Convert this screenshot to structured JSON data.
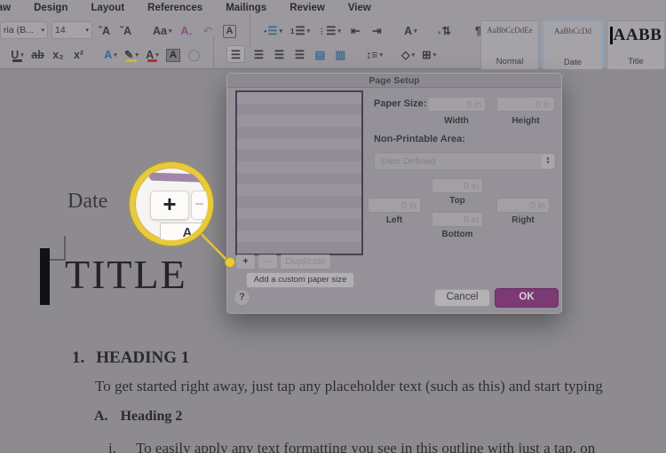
{
  "menu_tabs": [
    "Draw",
    "Design",
    "Layout",
    "References",
    "Mailings",
    "Review",
    "View"
  ],
  "ribbon": {
    "font_name": "ria (B...",
    "font_size": "14",
    "row1_icons": [
      {
        "name": "grow-font-icon",
        "glyph": "A",
        "pre2": "ˆ"
      },
      {
        "name": "shrink-font-icon",
        "glyph": "A",
        "pre2": "ˇ"
      },
      {
        "name": "spacer"
      },
      {
        "name": "change-case-icon",
        "glyph": "Aa",
        "chev": true
      },
      {
        "name": "clear-formatting-icon",
        "glyph": "A․",
        "color": "#8c4d86"
      },
      {
        "name": "circular-arrow-icon",
        "glyph": "↶",
        "faded": true
      },
      {
        "name": "character-border-icon",
        "glyph": "A",
        "box": true
      },
      {
        "name": "divider"
      },
      {
        "name": "bullet-list-icon",
        "glyph": "☰",
        "pre": "•",
        "chev": true,
        "color": "#3d6b94"
      },
      {
        "name": "numbered-list-icon",
        "glyph": "☰",
        "pre": "1",
        "chev": true
      },
      {
        "name": "multilevel-list-icon",
        "glyph": "☰",
        "pre": "⋮",
        "chev": true
      },
      {
        "name": "decrease-indent-icon",
        "glyph": "⇤"
      },
      {
        "name": "increase-indent-icon",
        "glyph": "⇥"
      },
      {
        "name": "spacer"
      },
      {
        "name": "text-effects-icon",
        "glyph": "A",
        "chev": true
      },
      {
        "name": "spacer"
      },
      {
        "name": "sort-icon",
        "glyph": "⇅",
        "pre": "₂"
      },
      {
        "name": "spacer"
      },
      {
        "name": "pilcrow-icon",
        "glyph": "¶"
      }
    ],
    "row2_icons": [
      {
        "name": "underline-icon",
        "glyph": "U",
        "chev": true,
        "bar": "#3c3a3f"
      },
      {
        "name": "strikethrough-icon",
        "glyph": "ab",
        "strike": true
      },
      {
        "name": "subscript-icon",
        "glyph": "x₂"
      },
      {
        "name": "superscript-icon",
        "glyph": "x²"
      },
      {
        "name": "spacer"
      },
      {
        "name": "text-effects-color-icon",
        "glyph": "A",
        "color": "#2f6a9e",
        "chev": true
      },
      {
        "name": "highlight-icon",
        "glyph": "✎",
        "bar": "#cdb92f",
        "chev": true
      },
      {
        "name": "font-color-icon",
        "glyph": "A",
        "bar": "#a8352c",
        "chev": true
      },
      {
        "name": "character-shading-icon",
        "glyph": "A",
        "darkbox": true
      },
      {
        "name": "circle-icon",
        "glyph": "◯",
        "faded": true
      },
      {
        "name": "divider"
      },
      {
        "name": "align-left-icon",
        "glyph": "☰",
        "active": true
      },
      {
        "name": "align-center-icon",
        "glyph": "☰"
      },
      {
        "name": "align-right-icon",
        "glyph": "☰"
      },
      {
        "name": "justify-icon",
        "glyph": "☰"
      },
      {
        "name": "distribute-icon",
        "glyph": "▤",
        "color": "#3d6b94"
      },
      {
        "name": "grid-text-icon",
        "glyph": "▥",
        "color": "#3d6b94"
      },
      {
        "name": "spacer"
      },
      {
        "name": "line-spacing-icon",
        "glyph": "↕≡",
        "chev": true
      },
      {
        "name": "spacer"
      },
      {
        "name": "shading-bucket-icon",
        "glyph": "◇",
        "chev": true
      },
      {
        "name": "borders-icon",
        "glyph": "⊞",
        "chev": true
      }
    ],
    "styles": [
      {
        "name": "style-normal",
        "preview": "AaBbCcDdEe",
        "label": "Normal",
        "selected": false,
        "cursor": false,
        "big": false
      },
      {
        "name": "style-date",
        "preview": "AaBbCcDd",
        "label": "Date",
        "selected": true,
        "cursor": false,
        "big": false
      },
      {
        "name": "style-title",
        "preview": "AABB",
        "label": "Title",
        "selected": false,
        "cursor": true,
        "big": true
      }
    ]
  },
  "dialog": {
    "title": "Page Setup",
    "paper_size_label": "Paper Size:",
    "width": {
      "value": "0 in",
      "label": "Width"
    },
    "height": {
      "value": "0 in",
      "label": "Height"
    },
    "nonprintable_label": "Non-Printable Area:",
    "nonprintable_value": "User Defined",
    "margins": {
      "top": {
        "value": "0 in",
        "label": "Top"
      },
      "left": {
        "value": "0 in",
        "label": "Left"
      },
      "right": {
        "value": "0 in",
        "label": "Right"
      },
      "bottom": {
        "value": "0 in",
        "label": "Bottom"
      }
    },
    "add_label": "+",
    "remove_label": "—",
    "duplicate_label": "Duplicate",
    "tooltip": "Add a custom paper size",
    "help_label": "?",
    "cancel_label": "Cancel",
    "ok_label": "OK"
  },
  "document": {
    "date": "Date",
    "title": "TITLE",
    "h1_number": "1.",
    "h1_text": "HEADING 1",
    "body1": "To get started right away, just tap any placeholder text (such as this) and start typing",
    "h2_number": "A.",
    "h2_text": "Heading 2",
    "body2_number": "i.",
    "body2": "To easily apply any text formatting you see in this outline with just a tap, on"
  },
  "magnifier": {
    "plus_label": "+",
    "minus_label": "–",
    "tooltip_partial": "A"
  },
  "colors": {
    "accent_ok": "#7c3a75",
    "annotation_yellow": "#e9c93d",
    "listbox_border": "#4e3d50",
    "style_selected_border": "#8aa5c5"
  }
}
